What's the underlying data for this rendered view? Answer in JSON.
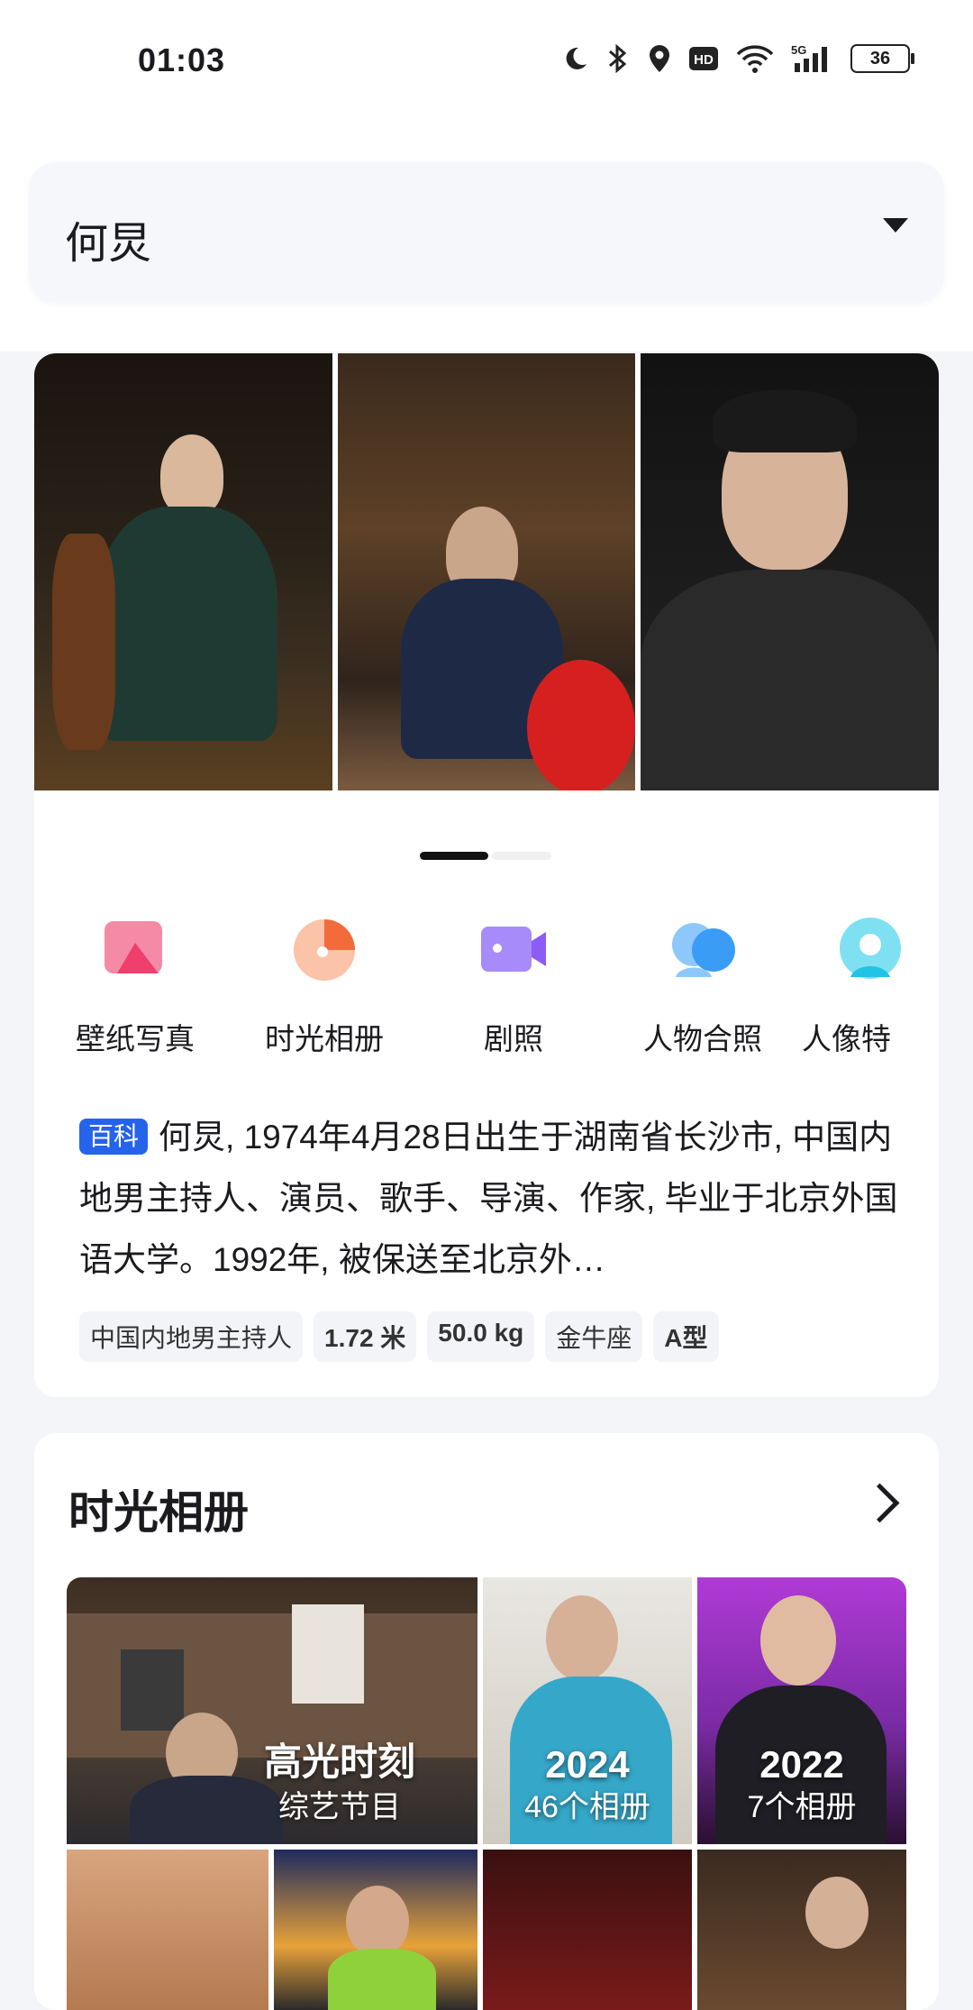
{
  "status_bar": {
    "time": "01:03",
    "battery": "36",
    "icons": [
      "moon-icon",
      "bluetooth-icon",
      "location-icon",
      "hd-icon",
      "wifi-icon",
      "5g-signal-icon"
    ]
  },
  "search": {
    "query": "何炅"
  },
  "gallery": {
    "photo_count": 3
  },
  "categories": [
    {
      "label": "壁纸写真",
      "icon": "wallpaper-icon",
      "color": "#f2557a"
    },
    {
      "label": "时光相册",
      "icon": "time-album-icon",
      "color": "#f26b3a"
    },
    {
      "label": "剧照",
      "icon": "video-still-icon",
      "color": "#8b5cf6"
    },
    {
      "label": "人物合照",
      "icon": "group-photo-icon",
      "color": "#3b9cf6"
    },
    {
      "label": "人像特",
      "icon": "portrait-icon",
      "color": "#22c3e6"
    }
  ],
  "intro": {
    "badge": "百科",
    "text": "何炅, 1974年4月28日出生于湖南省长沙市, 中国内地男主持人、演员、歌手、导演、作家, 毕业于北京外国语大学。1992年, 被保送至北京外…"
  },
  "tags": [
    "中国内地男主持人",
    "1.72 米",
    "50.0 kg",
    "金牛座",
    "A型"
  ],
  "albums": {
    "title": "时光相册",
    "tiles": [
      {
        "title": "高光时刻",
        "subtitle": "综艺节目"
      },
      {
        "title": "2024",
        "subtitle": "46个相册"
      },
      {
        "title": "2022",
        "subtitle": "7个相册"
      }
    ]
  }
}
